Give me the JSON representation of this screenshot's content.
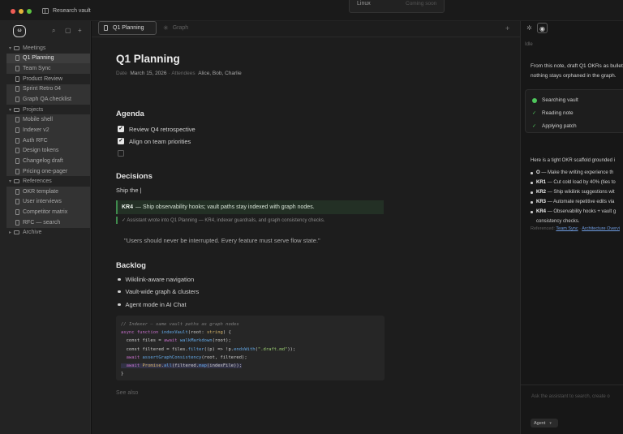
{
  "window": {
    "vault_name": "Research vault"
  },
  "os_menu": {
    "label": "Linux",
    "status": "Coming soon"
  },
  "sidebar": {
    "folders": [
      {
        "name": "Meetings",
        "notes": [
          "Q1 Planning",
          "Team Sync",
          "Product Review",
          "Sprint Retro 04",
          "Graph QA checklist"
        ]
      },
      {
        "name": "Projects",
        "notes": [
          "Mobile shell",
          "Indexer v2",
          "Auth RFC",
          "Design tokens",
          "Changelog draft",
          "Pricing one-pager"
        ]
      },
      {
        "name": "References",
        "notes": [
          "OKR template",
          "User interviews",
          "Competitor matrix",
          "RFC — search"
        ]
      },
      {
        "name": "Archive",
        "notes": []
      }
    ],
    "active_note": "Q1 Planning"
  },
  "tabs": {
    "active": "Q1 Planning",
    "graph": "Graph",
    "new_tab": "+"
  },
  "doc": {
    "title": "Q1 Planning",
    "meta": {
      "date_label": "Date",
      "date": "March 15, 2026",
      "attendees_label": "Attendees",
      "attendees": "Alice, Bob, Charlie"
    },
    "agenda": {
      "heading": "Agenda",
      "items": [
        {
          "text": "Review Q4 retrospective",
          "checked": true
        },
        {
          "text": "Align on team priorities",
          "checked": true
        },
        {
          "text": "",
          "checked": false
        }
      ]
    },
    "decisions": {
      "heading": "Decisions",
      "text": "Ship the |",
      "kr_label": "KR4",
      "kr_text": "— Ship observability hooks; vault paths stay indexed with graph nodes.",
      "agent_note": "✓ Assistant wrote into Q1 Planning — KR4, indexer guardrails, and graph consistency checks.",
      "quote": "\"Users should never be interrupted. Every feature must serve flow state.\""
    },
    "backlog": {
      "heading": "Backlog",
      "items": [
        "Wikilink-aware navigation",
        "Vault-wide graph & clusters",
        "Agent mode in AI Chat"
      ]
    },
    "code": {
      "comment": "// Indexer — same vault paths as graph nodes",
      "lines": [
        [
          "async function ",
          "indexVault",
          "(root: ",
          "string",
          ") {"
        ],
        [
          "  const files = ",
          "await ",
          "walkMarkdown",
          "(root);"
        ],
        [
          "  const filtered = files.",
          "filter",
          "((p) => !p.",
          "endsWith",
          "(",
          "\".draft.md\"",
          "));"
        ],
        [
          "  ",
          "await ",
          "assertGraphConsistency",
          "(root, filtered);"
        ],
        [
          "  ",
          "await ",
          "Promise",
          ".",
          "all",
          "(filtered.",
          "map",
          "(indexFile));"
        ],
        [
          "}"
        ]
      ]
    },
    "see_also": "See also"
  },
  "assistant": {
    "status": "Idle",
    "prompt_line1": "From this note, draft Q1 OKRs as bullets",
    "prompt_line2": "nothing stays orphaned in the graph.",
    "steps": [
      "Searching vault",
      "Reading note",
      "Applying patch"
    ],
    "intro": "Here is a tight OKR scaffold grounded i",
    "okrs": [
      {
        "key": "O",
        "text": "— Make the writing experience th"
      },
      {
        "key": "KR1",
        "text": "— Cut cold load by 40% (ties to"
      },
      {
        "key": "KR2",
        "text": "— Ship wikilink suggestions wit"
      },
      {
        "key": "KR3",
        "text": "— Automate repetitive edits via"
      },
      {
        "key": "KR4",
        "text": "— Observability hooks + vault g",
        "cont": "consistency checks."
      }
    ],
    "refs_label": "Referenced:",
    "refs": [
      "Team Sync",
      "Architecture Overvi"
    ],
    "input_placeholder": "Ask the assistant to search, create o",
    "mode": "Agent"
  }
}
